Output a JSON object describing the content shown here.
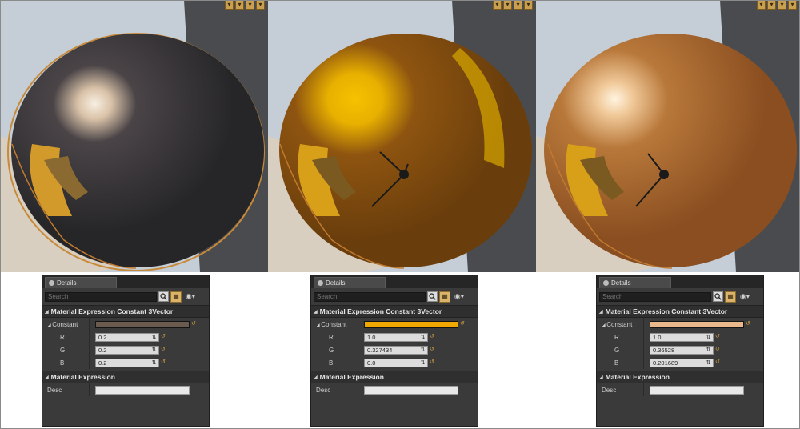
{
  "panels": [
    {
      "tab_title": "Details",
      "search_placeholder": "Search",
      "section_title": "Material Expression Constant 3Vector",
      "constant_label": "Constant",
      "constant_color": "#6b5a4e",
      "r_label": "R",
      "r_value": "0.2",
      "g_label": "G",
      "g_value": "0.2",
      "b_label": "B",
      "b_value": "0.2",
      "section2_title": "Material Expression",
      "desc_label": "Desc",
      "icons": {
        "search": "search-icon",
        "grid": "grid-icon",
        "eye": "eye-icon"
      }
    },
    {
      "tab_title": "Details",
      "search_placeholder": "Search",
      "section_title": "Material Expression Constant 3Vector",
      "constant_label": "Constant",
      "constant_color": "#f0a800",
      "r_label": "R",
      "r_value": "1.0",
      "g_label": "G",
      "g_value": "0.327434",
      "b_label": "B",
      "b_value": "0.0",
      "section2_title": "Material Expression",
      "desc_label": "Desc",
      "icons": {
        "search": "search-icon",
        "grid": "grid-icon",
        "eye": "eye-icon"
      }
    },
    {
      "tab_title": "Details",
      "search_placeholder": "Search",
      "section_title": "Material Expression Constant 3Vector",
      "constant_label": "Constant",
      "constant_color": "#e8b88c",
      "r_label": "R",
      "r_value": "1.0",
      "g_label": "G",
      "g_value": "0.36528",
      "b_label": "B",
      "b_value": "0.201689",
      "section2_title": "Material Expression",
      "desc_label": "Desc",
      "icons": {
        "search": "search-icon",
        "grid": "grid-icon",
        "eye": "eye-icon"
      }
    }
  ],
  "viewports": [
    {
      "sphere_color": "#303032",
      "highlight": "#f4e2c8"
    },
    {
      "sphere_color": "#9a5a10",
      "highlight": "#f0b800"
    },
    {
      "sphere_color": "#a9652a",
      "highlight": "#fff1d8"
    }
  ],
  "colors": {
    "background": "#c8d0d8",
    "panel": "#3a3a3a",
    "accent": "#d9b46a"
  }
}
